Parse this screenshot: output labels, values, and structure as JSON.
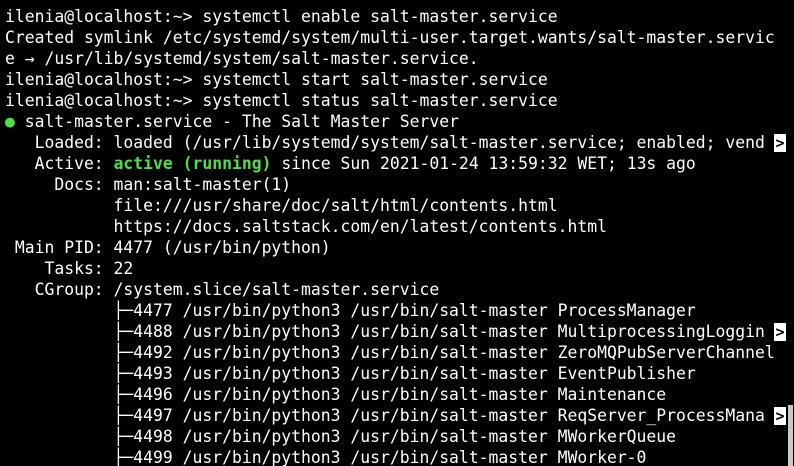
{
  "terminal": {
    "lines": [
      "ilenia@localhost:~> systemctl enable salt-master.service",
      "Created symlink /etc/systemd/system/multi-user.target.wants/salt-master.servic",
      "e → /usr/lib/systemd/system/salt-master.service.",
      "ilenia@localhost:~> systemctl start salt-master.service",
      "ilenia@localhost:~> systemctl status salt-master.service"
    ],
    "status": {
      "dot": "●",
      "header": " salt-master.service - The Salt Master Server",
      "loaded": "   Loaded: loaded (/usr/lib/systemd/system/salt-master.service; enabled; vend",
      "active_label": "   Active: ",
      "active_value": "active (running)",
      "active_rest": " since Sun 2021-01-24 13:59:32 WET; 13s ago",
      "docs_1": "     Docs: man:salt-master(1)",
      "docs_2": "           file:///usr/share/doc/salt/html/contents.html",
      "docs_3": "           https://docs.saltstack.com/en/latest/contents.html",
      "main_pid": " Main PID: 4477 (/usr/bin/python)",
      "tasks": "    Tasks: 22",
      "cgroup": "   CGroup: /system.slice/salt-master.service"
    },
    "processes": [
      "           ├─4477 /usr/bin/python3 /usr/bin/salt-master ProcessManager",
      "           ├─4488 /usr/bin/python3 /usr/bin/salt-master MultiprocessingLoggin",
      "           ├─4492 /usr/bin/python3 /usr/bin/salt-master ZeroMQPubServerChannel",
      "           ├─4493 /usr/bin/python3 /usr/bin/salt-master EventPublisher",
      "           ├─4496 /usr/bin/python3 /usr/bin/salt-master Maintenance",
      "           ├─4497 /usr/bin/python3 /usr/bin/salt-master ReqServer_ProcessMana",
      "           ├─4498 /usr/bin/python3 /usr/bin/salt-master MWorkerQueue",
      "           ├─4499 /usr/bin/python3 /usr/bin/salt-master MWorker-0"
    ],
    "truncation_marker": ">"
  }
}
